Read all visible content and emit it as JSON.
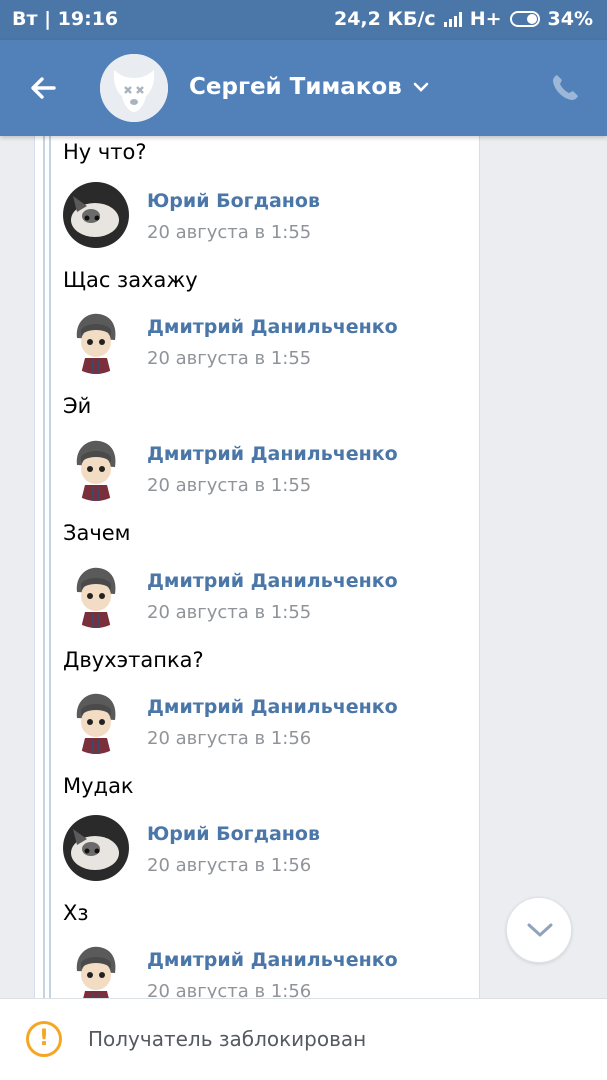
{
  "statusbar": {
    "left_text": "Вт | 19:16",
    "speed": "24,2 КБ/с",
    "network": "H+",
    "battery": "34%"
  },
  "header": {
    "title": "Сергей Тимаков",
    "icons": [
      "back-arrow-icon",
      "chevron-down-icon",
      "phone-icon"
    ]
  },
  "messages": [
    {
      "text": "Ну что?"
    },
    {
      "author": "Юрий Богданов",
      "date": "20 августа в 1:55",
      "text": "Щас захажу"
    },
    {
      "author": "Дмитрий Данильченко",
      "date": "20 августа в 1:55",
      "text": "Эй"
    },
    {
      "author": "Дмитрий Данильченко",
      "date": "20 августа в 1:55",
      "text": "Зачем"
    },
    {
      "author": "Дмитрий Данильченко",
      "date": "20 августа в 1:55",
      "text": "Двухэтапка?"
    },
    {
      "author": "Дмитрий Данильченко",
      "date": "20 августа в 1:56",
      "text": "Мудак"
    },
    {
      "author": "Юрий Богданов",
      "date": "20 августа в 1:56",
      "text": "Хз"
    },
    {
      "author": "Дмитрий Данильченко",
      "date": "20 августа в 1:56"
    }
  ],
  "footer": {
    "blocked_text": "Получатель заблокирован"
  },
  "colors": {
    "header": "#5181b8",
    "statusbar": "#4a76a8",
    "link": "#4a76a8",
    "warning": "#f5a623"
  }
}
